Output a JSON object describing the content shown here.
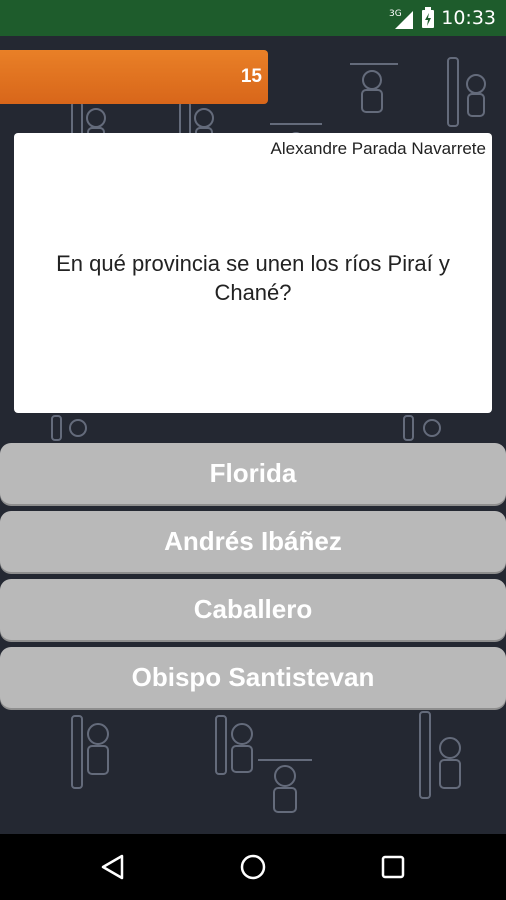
{
  "status_bar": {
    "network": "3G",
    "time": "10:33"
  },
  "game": {
    "timer_value": "15",
    "timer_fraction": 0.53
  },
  "question": {
    "author": "Alexandre Parada Navarrete",
    "text": "En qué provincia se unen los ríos Piraí y Chané?"
  },
  "answers": [
    {
      "label": "Florida"
    },
    {
      "label": "Andrés Ibáñez"
    },
    {
      "label": "Caballero"
    },
    {
      "label": "Obispo Santistevan"
    }
  ],
  "colors": {
    "status_bar": "#1e5c2c",
    "timer": "#e07421",
    "answer_button": "#b9b9b9",
    "background": "#242832"
  },
  "nav": {
    "icons": [
      "back-icon",
      "home-icon",
      "recents-icon"
    ]
  }
}
